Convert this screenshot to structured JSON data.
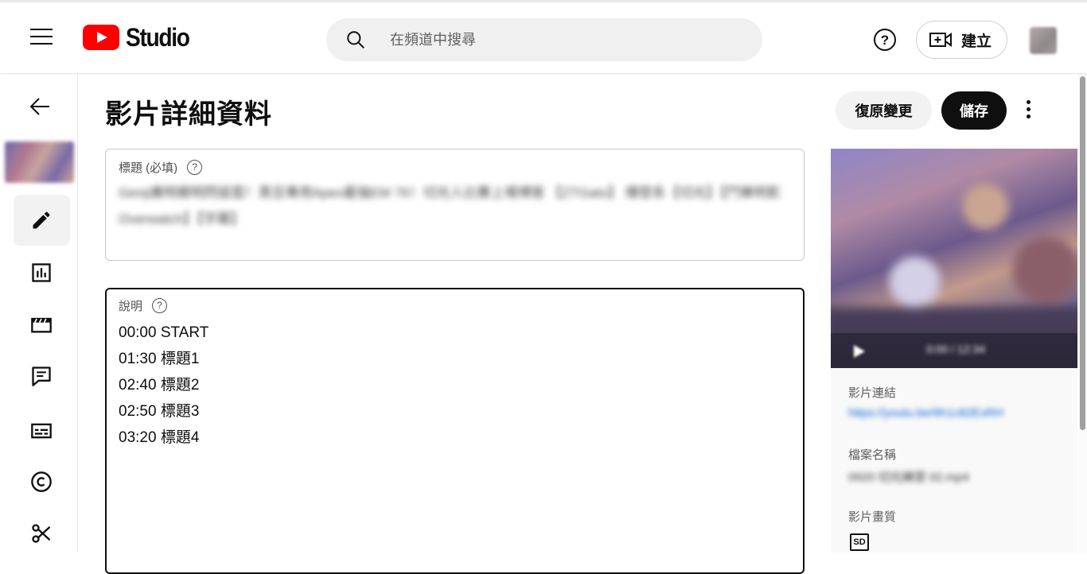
{
  "header": {
    "logo_text": "Studio",
    "search_placeholder": "在頻道中搜尋",
    "help_label": "?",
    "create_label": "建立"
  },
  "page": {
    "title": "影片詳細資料",
    "undo_label": "復原變更",
    "save_label": "儲存"
  },
  "title_field": {
    "label": "標題 (必填)",
    "value": "Genji廣明鄉明閃拔雲！黑豆專用Apex最強EM 76！切光人比賽上場博客 【ZTGato】 爆發系【切光】【鬥樂明影 Overwatch】【字幕】"
  },
  "description_field": {
    "label": "說明",
    "lines": [
      "00:00 START",
      "01:30 標題1",
      "02:40 標題2",
      "02:50 標題3",
      "03:20 標題4"
    ]
  },
  "side_panel": {
    "player_time": "0:00 / 12:34",
    "link_label": "影片連結",
    "link_value": "https://youtu.be/9h1c82ExRH",
    "file_label": "檔案名稱",
    "file_value": "0920 切光練習 02.mp4",
    "quality_label": "影片畫質",
    "quality_badge": "SD"
  },
  "colors": {
    "brand_red": "#ff0000",
    "save_button": "#0f0f0f",
    "link_blue": "#065fd4"
  }
}
